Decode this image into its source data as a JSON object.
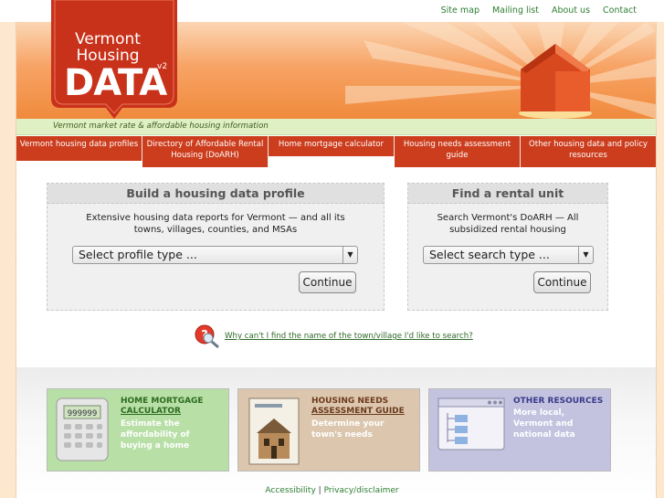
{
  "toplinks": [
    "Site map",
    "Mailing list",
    "About us",
    "Contact"
  ],
  "logo": {
    "line1": "Vermont",
    "line2": "Housing",
    "word": "DATA",
    "version": "v2"
  },
  "tagline": "Vermont market rate & affordable housing information",
  "nav": [
    "Vermont housing data profiles",
    "Directory of Affordable Rental Housing (DoARH)",
    "Home mortgage calculator",
    "Housing needs assessment guide",
    "Other housing data and policy resources"
  ],
  "profile_box": {
    "title": "Build a housing data profile",
    "desc": "Extensive housing data reports for Vermont — and all its towns, villages, counties, and MSAs",
    "select": "Select profile type ...",
    "button": "Continue"
  },
  "rental_box": {
    "title": "Find a rental unit",
    "desc": "Search Vermont's DoARH — All subsidized rental housing",
    "select": "Select search type ...",
    "button": "Continue"
  },
  "help_link": "Why can't I find the name of the town/village I'd like to search?",
  "promos": {
    "mortgage": {
      "title1": "HOME MORTGAGE",
      "title2": "CALCULATOR",
      "sub": "Estimate the affordability of buying a home",
      "bg": "#b8dfa6",
      "title_color": "#2c6b1f",
      "screen": "999999"
    },
    "needs": {
      "title1": "HOUSING NEEDS",
      "title2": "ASSESSMENT GUIDE",
      "sub": "Determine your town's needs",
      "bg": "#dcc7ae",
      "title_color": "#6b3a1c"
    },
    "other": {
      "title1": "OTHER RESOURCES",
      "sub": "More local, Vermont and national data",
      "bg": "#c3c3e0",
      "title_color": "#3a3a8a"
    }
  },
  "footer": {
    "accessibility": "Accessibility",
    "sep": "|",
    "privacy": "Privacy/disclaimer"
  },
  "colors": {
    "nav_red": "#cc3d1d",
    "banner_orange": "#f08a3c",
    "link_green": "#2e7d32"
  }
}
